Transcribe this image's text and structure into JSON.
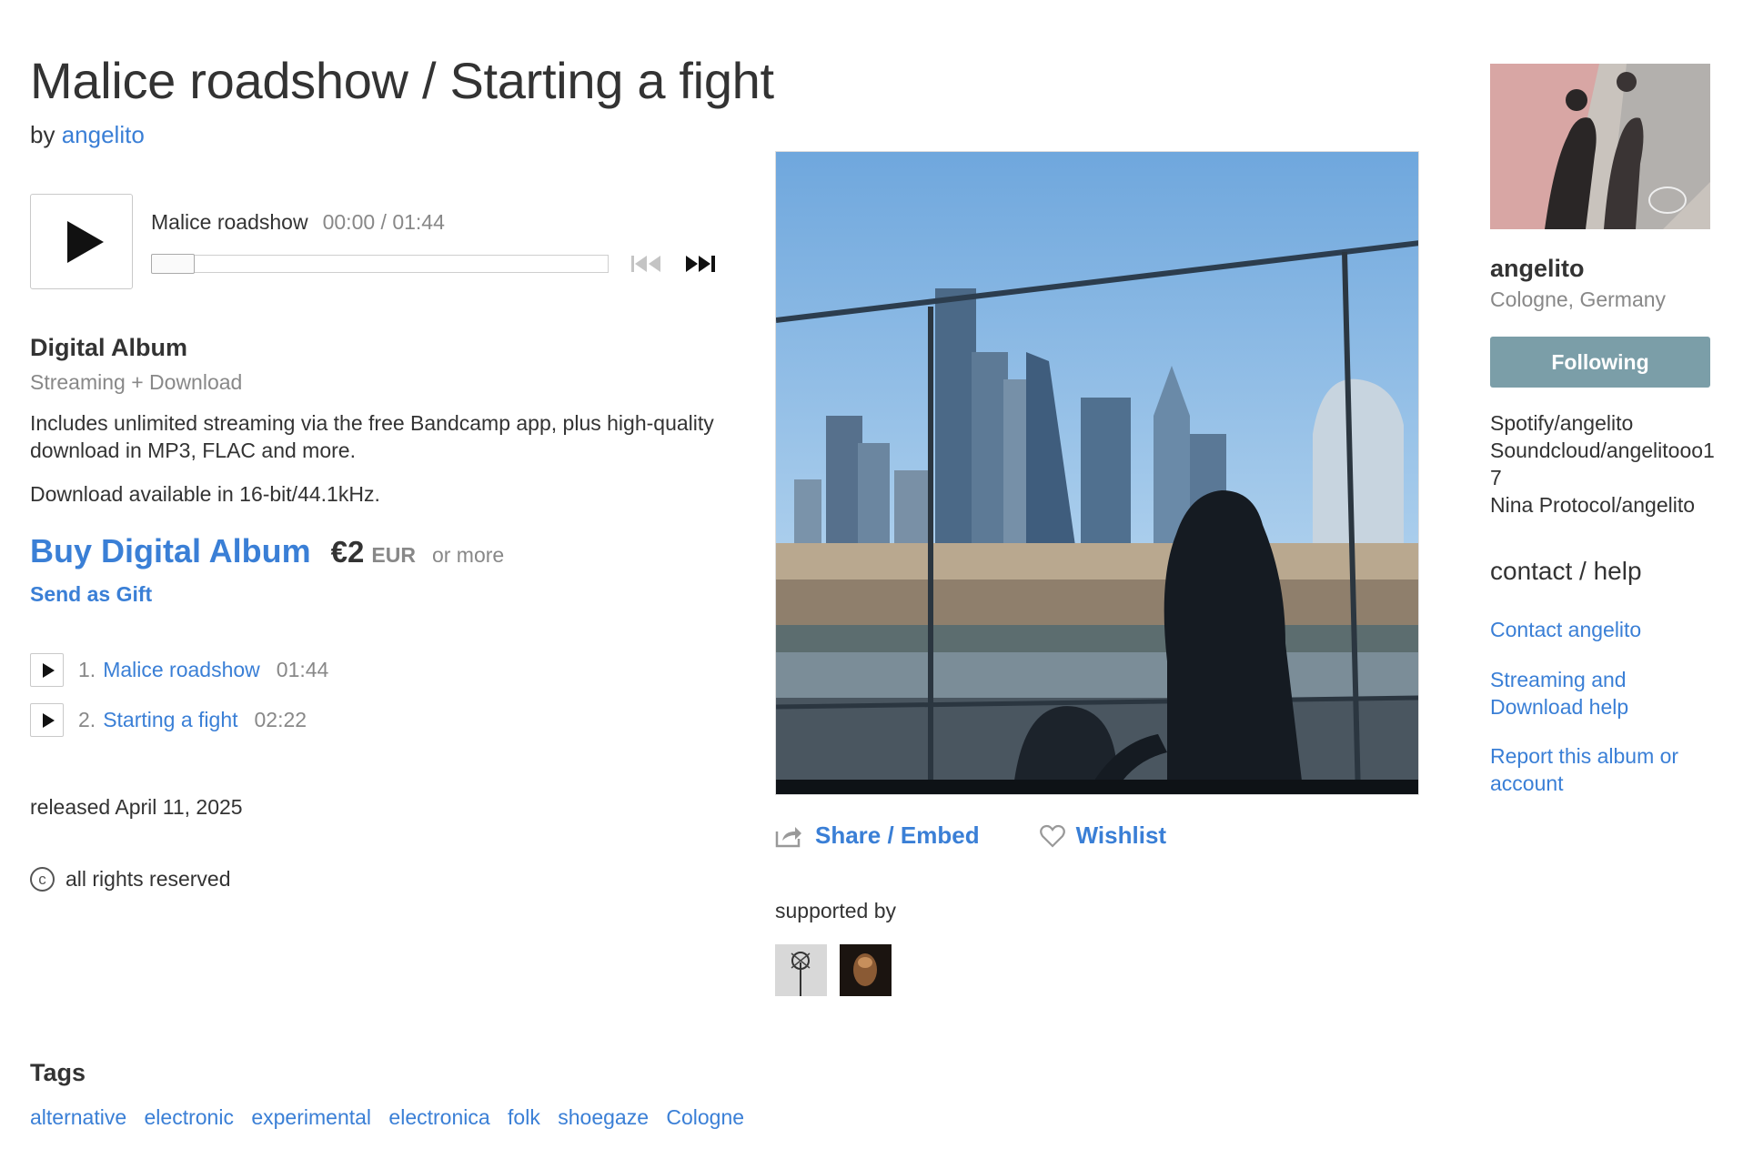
{
  "album": {
    "title": "Malice roadshow / Starting a fight",
    "by_prefix": "by",
    "artist": "angelito"
  },
  "player": {
    "track_title": "Malice roadshow",
    "time": "00:00 / 01:44",
    "progress": 0
  },
  "digital_album": {
    "heading": "Digital Album",
    "subheading": "Streaming + Download",
    "description": "Includes unlimited streaming via the free Bandcamp app, plus high-quality download in MP3, FLAC and more.",
    "availability": "Download available in 16-bit/44.1kHz.",
    "buy_label": "Buy Digital Album",
    "price": "€2",
    "currency": "EUR",
    "or_more": "or more",
    "gift_label": "Send as Gift"
  },
  "tracks": [
    {
      "num": "1.",
      "name": "Malice roadshow",
      "duration": "01:44"
    },
    {
      "num": "2.",
      "name": "Starting a fight",
      "duration": "02:22"
    }
  ],
  "released": "released April 11, 2025",
  "rights": "all rights reserved",
  "tags": {
    "heading": "Tags",
    "items": [
      "alternative",
      "electronic",
      "experimental",
      "electronica",
      "folk",
      "shoegaze",
      "Cologne"
    ]
  },
  "actions": {
    "share_label": "Share / Embed",
    "wishlist_label": "Wishlist"
  },
  "supported_by": "supported by",
  "sidebar": {
    "artist_name": "angelito",
    "location": "Cologne, Germany",
    "follow_label": "Following",
    "links_text": [
      "Spotify/angelito",
      "Soundcloud/angelitooo17",
      "Nina Protocol/angelito"
    ],
    "contact_heading": "contact / help",
    "contact_link": "Contact angelito",
    "streaming_help": "Streaming and Download help",
    "report_link": "Report this album or account"
  },
  "colors": {
    "link": "#3a7fd6",
    "follow_button": "#7b9ea8",
    "muted_text": "#888888"
  },
  "icons": [
    "play-icon",
    "prev-track-icon",
    "next-track-icon",
    "share-icon",
    "heart-icon",
    "copyright-icon"
  ]
}
